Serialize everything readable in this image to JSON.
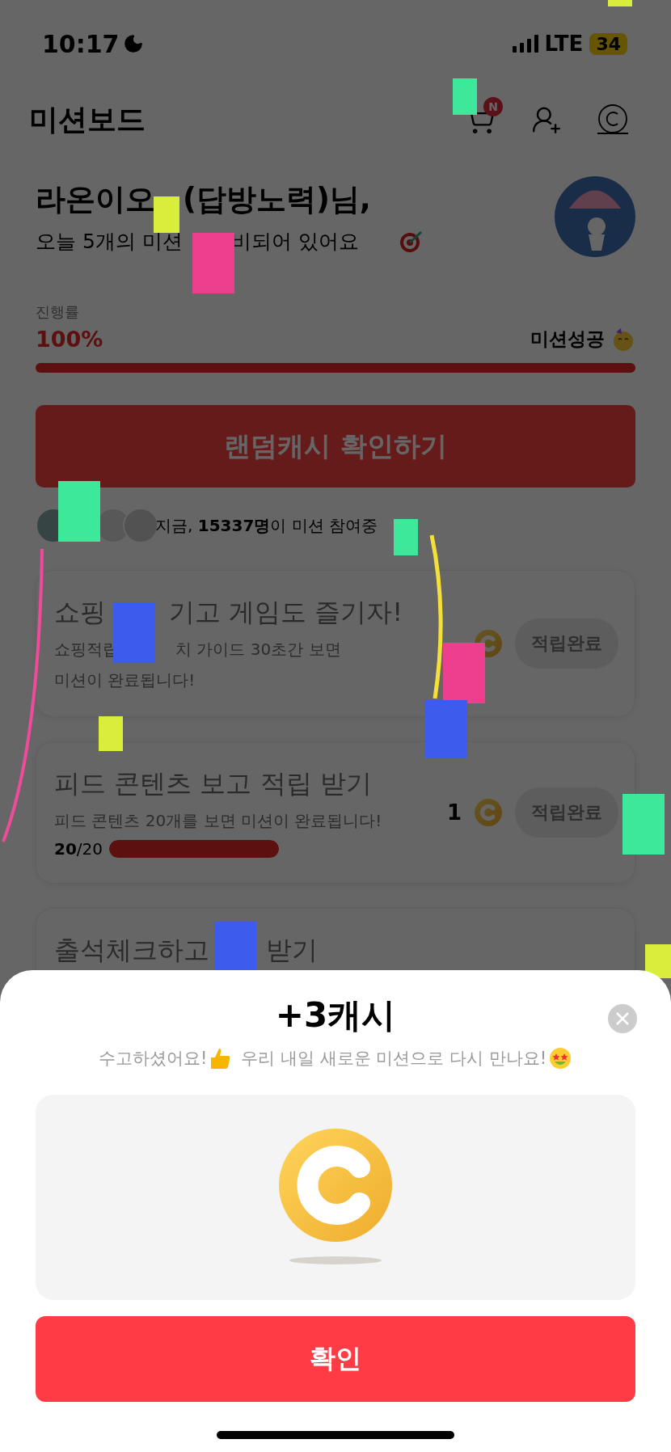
{
  "status_bar": {
    "time": "10:17",
    "network": "LTE",
    "battery": "34"
  },
  "header": {
    "title": "미션보드",
    "cart_badge": "N"
  },
  "greeting": {
    "name_parts": [
      "라온이오",
      "(답방노력)님,"
    ],
    "message_parts": [
      "오늘 5개의 미션",
      "비되어 있어요"
    ]
  },
  "progress": {
    "label": "진행률",
    "percent": "100%",
    "level": 1,
    "status": "미션성공"
  },
  "random_cash_button": "랜덤캐시 확인하기",
  "participants": {
    "text": "지금, **15337명**이 미션 참여중"
  },
  "missions": [
    {
      "title_parts": [
        "쇼핑",
        "기고 게임도 즐기자!"
      ],
      "description_lines": [
        [
          "쇼핑적립",
          "치 가이드 30초간 보면"
        ],
        [
          "미션이 완료됩니다!"
        ]
      ],
      "coin": true,
      "button": "적립완료"
    },
    {
      "title_parts": [
        "피드 콘텐츠 보고 적립 받기"
      ],
      "description_lines": [
        [
          "피드 콘텐츠 20개를 보면 미션이 완료됩니다!"
        ]
      ],
      "reward": "1",
      "coin": true,
      "count": "**20**/20",
      "level": 1,
      "button": "적립완료"
    },
    {
      "title_parts": [
        "출석체크하고",
        "받기"
      ]
    }
  ],
  "reward_sheet": {
    "title": "+3캐시",
    "message_parts": [
      "수고하셨어요!",
      "우리 내일 새로운 미션으로 다시 만나요!"
    ],
    "confirm": "확인"
  }
}
